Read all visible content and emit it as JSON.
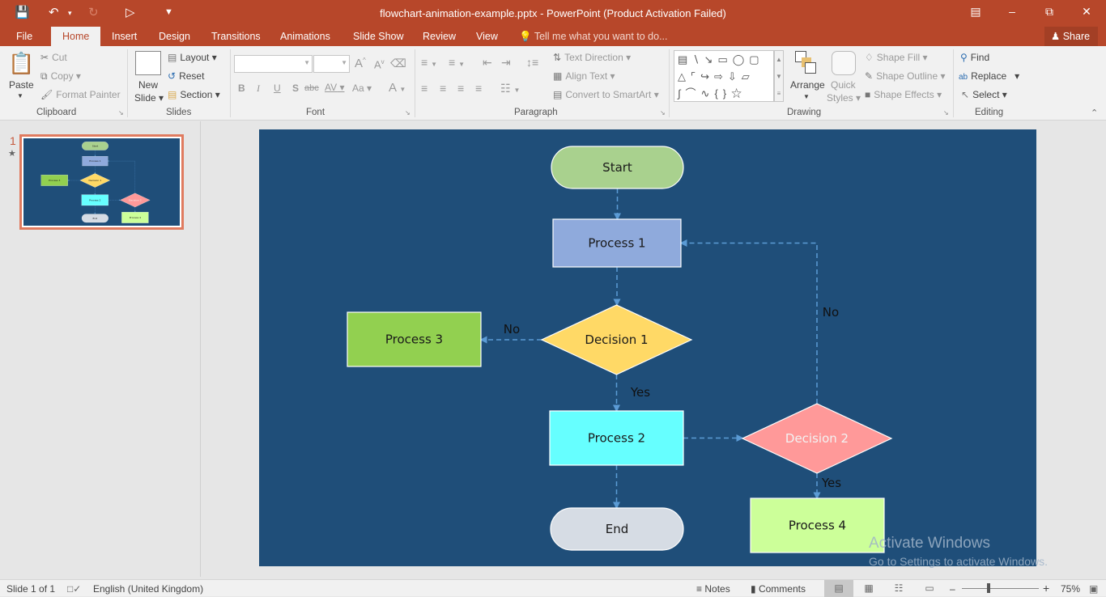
{
  "window": {
    "title": "flowchart-animation-example.pptx - PowerPoint (Product Activation Failed)",
    "quick_access": [
      "save-icon",
      "undo-icon",
      "redo-icon",
      "start-from-beginning-icon",
      "customize-icon"
    ]
  },
  "tabs": [
    "File",
    "Home",
    "Insert",
    "Design",
    "Transitions",
    "Animations",
    "Slide Show",
    "Review",
    "View"
  ],
  "active_tab": "Home",
  "tell_me_placeholder": "Tell me what you want to do...",
  "share_label": "Share",
  "ribbon": {
    "clipboard": {
      "label": "Clipboard",
      "paste": "Paste",
      "cut": "Cut",
      "copy": "Copy",
      "format_painter": "Format Painter"
    },
    "slides": {
      "label": "Slides",
      "new_slide_line1": "New",
      "new_slide_line2": "Slide",
      "layout": "Layout",
      "reset": "Reset",
      "section": "Section"
    },
    "font": {
      "label": "Font",
      "font_name": "",
      "font_size": "",
      "bold": "B",
      "italic": "I",
      "underline": "U",
      "shadow": "S",
      "strike": "abc",
      "spacing": "AV",
      "case": "Aa",
      "color": "A",
      "grow": "A",
      "shrink": "A"
    },
    "paragraph": {
      "label": "Paragraph",
      "text_direction": "Text Direction",
      "align_text": "Align Text",
      "convert_smartart": "Convert to SmartArt"
    },
    "drawing": {
      "label": "Drawing",
      "arrange": "Arrange",
      "quick_styles_line1": "Quick",
      "quick_styles_line2": "Styles",
      "shape_fill": "Shape Fill",
      "shape_outline": "Shape Outline",
      "shape_effects": "Shape Effects"
    },
    "editing": {
      "label": "Editing",
      "find": "Find",
      "replace": "Replace",
      "select": "Select"
    }
  },
  "thumbnail": {
    "number": "1",
    "has_animation": true
  },
  "flowchart": {
    "nodes": [
      {
        "id": "start",
        "label": "Start",
        "shape": "terminator",
        "fill": "#a9d18e",
        "text": "#1a1a1a"
      },
      {
        "id": "p1",
        "label": "Process 1",
        "shape": "process",
        "fill": "#8faadc",
        "text": "#1a1a1a"
      },
      {
        "id": "d1",
        "label": "Decision 1",
        "shape": "decision",
        "fill": "#ffd966",
        "text": "#1a1a1a"
      },
      {
        "id": "p3",
        "label": "Process 3",
        "shape": "process",
        "fill": "#92d050",
        "text": "#1a1a1a"
      },
      {
        "id": "p2",
        "label": "Process 2",
        "shape": "process",
        "fill": "#66ffff",
        "text": "#1a1a1a"
      },
      {
        "id": "d2",
        "label": "Decision 2",
        "shape": "decision",
        "fill": "#ff9999",
        "text": "#f2f2f2"
      },
      {
        "id": "end",
        "label": "End",
        "shape": "terminator",
        "fill": "#d6dce4",
        "text": "#1a1a1a"
      },
      {
        "id": "p4",
        "label": "Process 4",
        "shape": "process",
        "fill": "#ccff99",
        "text": "#1a1a1a"
      }
    ],
    "edges": [
      {
        "from": "start",
        "to": "p1",
        "label": ""
      },
      {
        "from": "p1",
        "to": "d1",
        "label": ""
      },
      {
        "from": "d1",
        "to": "p3",
        "label": "No"
      },
      {
        "from": "d1",
        "to": "p2",
        "label": "Yes"
      },
      {
        "from": "p2",
        "to": "d2",
        "label": ""
      },
      {
        "from": "p2",
        "to": "end",
        "label": ""
      },
      {
        "from": "d2",
        "to": "p4",
        "label": "Yes"
      },
      {
        "from": "d2",
        "to": "p1",
        "label": "No"
      }
    ],
    "background": "#1f4e79",
    "connector_color": "#5b9bd5"
  },
  "watermark": {
    "line1": "Activate Windows",
    "line2": "Go to Settings to activate Windows."
  },
  "status": {
    "slide_info": "Slide 1 of 1",
    "language": "English (United Kingdom)",
    "notes": "Notes",
    "comments": "Comments",
    "zoom": "75%",
    "zoom_fraction": 0.35
  }
}
